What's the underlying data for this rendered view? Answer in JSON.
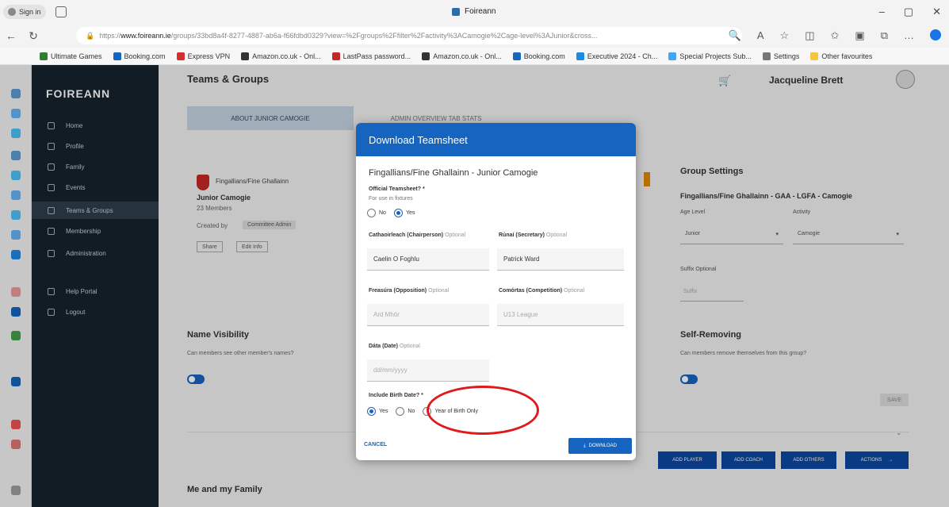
{
  "browser": {
    "profile_label": "Sign in",
    "tab_title": "Foireann",
    "url_prefix": "https://",
    "url_domain": "www.foireann.ie",
    "url_rest": "/groups/33bd8a4f-8277-4887-ab6a-f66fdbd0329?view=%2Fgroups%2Ffilter%2Factivity%3ACamogie%2Cage-level%3AJunior&cross...",
    "bookmarks": [
      "Ultimate Games",
      "Booking.com",
      "Express VPN",
      "Amazon.co.uk - Onl...",
      "LastPass password...",
      "Amazon.co.uk - Onl...",
      "Booking.com",
      "Executive 2024 - Ch...",
      "Special Projects Sub...",
      "Settings",
      "Other favourites"
    ]
  },
  "sidebar": {
    "brand": "FOIREANN",
    "items": [
      {
        "label": "Home"
      },
      {
        "label": "Profile"
      },
      {
        "label": "Family"
      },
      {
        "label": "Events"
      },
      {
        "label": "Teams & Groups"
      },
      {
        "label": "Membership"
      },
      {
        "label": "Administration"
      },
      {
        "label": "Help Portal"
      },
      {
        "label": "Logout"
      }
    ]
  },
  "header": {
    "page_title": "Teams & Groups",
    "user_name": "Jacqueline Brett"
  },
  "main": {
    "tab_active": "ABOUT JUNIOR CAMOGIE",
    "tab_other": "ADMIN OVERVIEW TAB STATS",
    "group_card": {
      "club": "Fingallians/Fine Ghallainn",
      "team": "Junior Camogie",
      "members": "23 Members",
      "created_by_label": "Created by",
      "created_by": "Committee Admin",
      "btn_share": "Share",
      "btn_edit": "Edit Info"
    },
    "group_settings": {
      "title": "Group Settings",
      "group_name": "Fingallians/Fine Ghallainn - GAA - LGFA - Camogie",
      "age_level_label": "Age Level",
      "age_level_value": "Junior",
      "activity_label": "Activity",
      "activity_value": "Camogie",
      "suffix_label": "Suffix Optional",
      "suffix_placeholder": "Suffix"
    },
    "name_visibility": {
      "title": "Name Visibility",
      "desc": "Can members see other member's names?"
    },
    "self_removing": {
      "title": "Self-Removing",
      "desc": "Can members remove themselves from this group?"
    },
    "save_label": "SAVE",
    "actions": [
      "ADD PLAYER",
      "ADD COACH",
      "ADD OTHERS",
      "ACTIONS"
    ],
    "family_title": "Me and my Family"
  },
  "modal": {
    "title": "Download Teamsheet",
    "group_name": "Fingallians/Fine Ghallainn - Junior Camogie",
    "official_label": "Official Teamsheet? *",
    "official_hint": "For use in fixtures",
    "official_no": "No",
    "official_yes": "Yes",
    "chair_label": "Cathaoirleach (Chairperson)",
    "chair_value": "Caelin O Foghlu",
    "secretary_label": "Rúnaí (Secretary)",
    "secretary_value": "Patrick Ward",
    "optional": "Optional",
    "opposition_label": "Freasúra (Opposition)",
    "opposition_placeholder": "Ard Mhór",
    "competition_label": "Comórtas (Competition)",
    "competition_placeholder": "U13 League",
    "date_label": "Dáta (Date)",
    "date_placeholder": "dd/mm/yyyy",
    "birth_label": "Include Birth Date? *",
    "birth_yes": "Yes",
    "birth_no": "No",
    "birth_year": "Year of Birth Only",
    "cancel": "CANCEL",
    "download": "DOWNLOAD"
  },
  "colors": {
    "accent": "#1565c0",
    "sidebar": "#17232e",
    "annotation": "#e0191b"
  }
}
